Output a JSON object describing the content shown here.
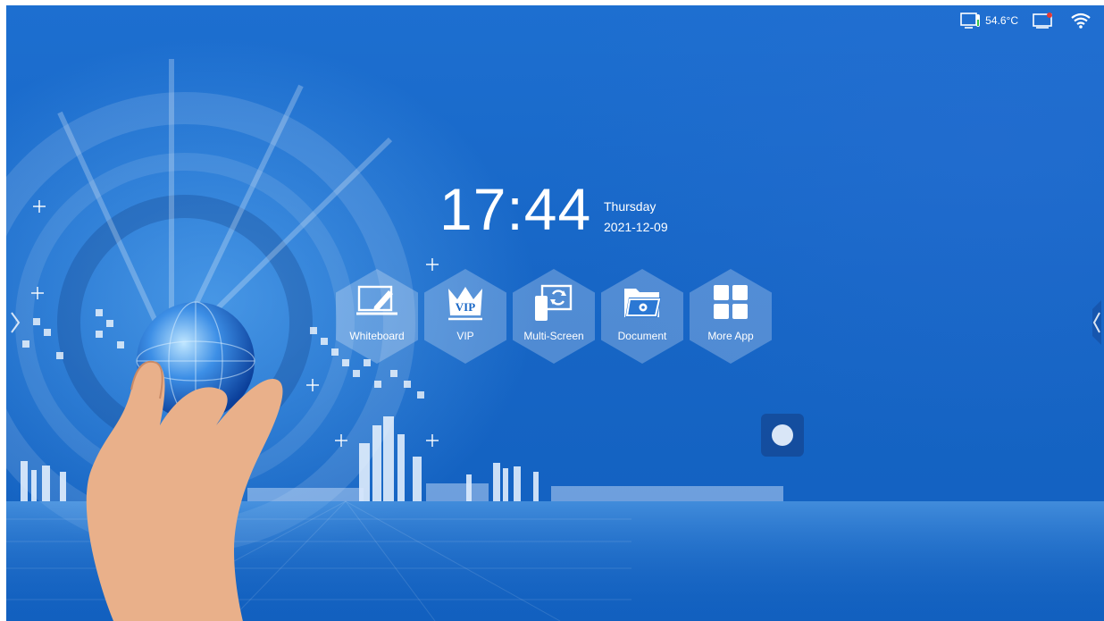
{
  "status_bar": {
    "temperature": "54.6°C"
  },
  "clock": {
    "time": "17:44",
    "weekday": "Thursday",
    "date": "2021-12-09"
  },
  "apps": [
    {
      "label": "Whiteboard",
      "icon": "whiteboard-icon"
    },
    {
      "label": "VIP",
      "icon": "vip-crown-icon"
    },
    {
      "label": "Multi-Screen",
      "icon": "multi-screen-icon"
    },
    {
      "label": "Document",
      "icon": "document-folder-icon"
    },
    {
      "label": "More App",
      "icon": "more-apps-grid-icon"
    }
  ],
  "vip_icon_text": "VIP",
  "colors": {
    "background": "#1766c6",
    "hex_tile": "rgba(255,255,255,0.25)",
    "text": "#ffffff"
  }
}
